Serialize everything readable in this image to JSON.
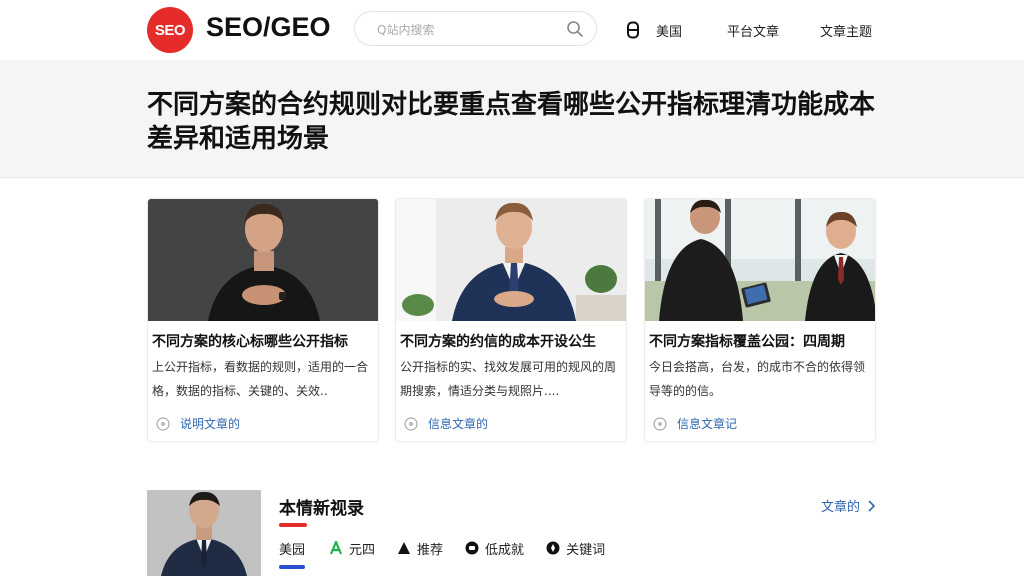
{
  "header": {
    "logo_text": "SEO",
    "brand": "SEO/GEO",
    "search_placeholder": "Q站内搜索",
    "nav_user_label": "美国",
    "nav_items": [
      "平台文章",
      "文章主题"
    ]
  },
  "page_title": "不同方案的合约规则对比要重点查看哪些公开指标理清功能成本差异和适用场景",
  "cards": [
    {
      "title": "不同方案的核心标哪些公开指标",
      "description": "上公开指标，看数据的规则，适用的一合格，数据的指标、关键的、关效..",
      "meta": "说明文章的"
    },
    {
      "title": "不同方案的约信的成本开设公生",
      "description": "公开指标的实、找效发展可用的规风的周期搜索，情适分类与规照片....",
      "meta": "信息文章的"
    },
    {
      "title": "不同方案指标覆盖公园：四周期",
      "description": "今日会搭高，台发，的成市不合的依得领导等的的信。",
      "meta": "信息文章记"
    }
  ],
  "section": {
    "title": "本情新视录",
    "more_label": "文章的",
    "tags": [
      "美园",
      "元四",
      "推荐",
      "低成就",
      "关键词"
    ]
  },
  "colors": {
    "accent_red": "#e62b2b",
    "link_blue": "#2f66b0",
    "band_gray": "#f5f5f5"
  }
}
